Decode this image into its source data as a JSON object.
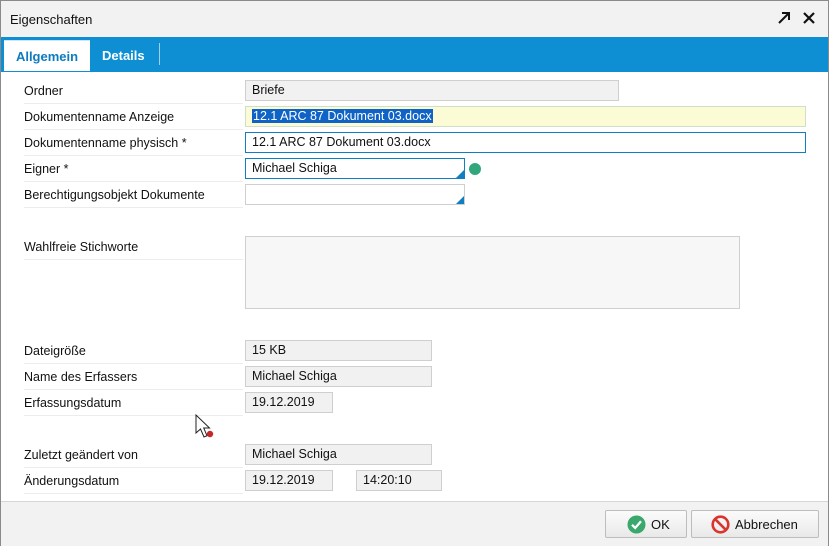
{
  "window": {
    "title": "Eigenschaften",
    "expand_icon": "expand-arrow-icon",
    "close_icon": "close-icon"
  },
  "tabs": [
    {
      "label": "Allgemein",
      "active": true
    },
    {
      "label": "Details",
      "active": false
    }
  ],
  "fields": {
    "ordner": {
      "label": "Ordner",
      "value": "Briefe"
    },
    "doc_name_display": {
      "label": "Dokumentenname Anzeige",
      "value": "12.1 ARC 87 Dokument 03.docx"
    },
    "doc_name_physical": {
      "label": "Dokumentenname physisch *",
      "value": "12.1 ARC 87 Dokument 03.docx"
    },
    "owner": {
      "label": "Eigner *",
      "value": "Michael Schiga",
      "status_color": "#33a77c"
    },
    "permission_object": {
      "label": "Berechtigungsobjekt Dokumente",
      "value": ""
    },
    "keywords": {
      "label": "Wahlfreie Stichworte",
      "value": ""
    },
    "file_size": {
      "label": "Dateigröße",
      "value": "15 KB"
    },
    "creator": {
      "label": "Name des Erfassers",
      "value": "Michael Schiga"
    },
    "created_date": {
      "label": "Erfassungsdatum",
      "value": "19.12.2019"
    },
    "modified_by": {
      "label": "Zuletzt geändert von",
      "value": "Michael Schiga"
    },
    "modified_date": {
      "label": "Änderungsdatum",
      "date": "19.12.2019",
      "time": "14:20:10"
    }
  },
  "buttons": {
    "ok": {
      "label": "OK",
      "icon": "check-circle-icon",
      "color": "#3aa76d"
    },
    "cancel": {
      "label": "Abbrechen",
      "icon": "prohibited-icon",
      "color": "#d9352e"
    }
  },
  "colors": {
    "accent": "#0e8fd4"
  }
}
